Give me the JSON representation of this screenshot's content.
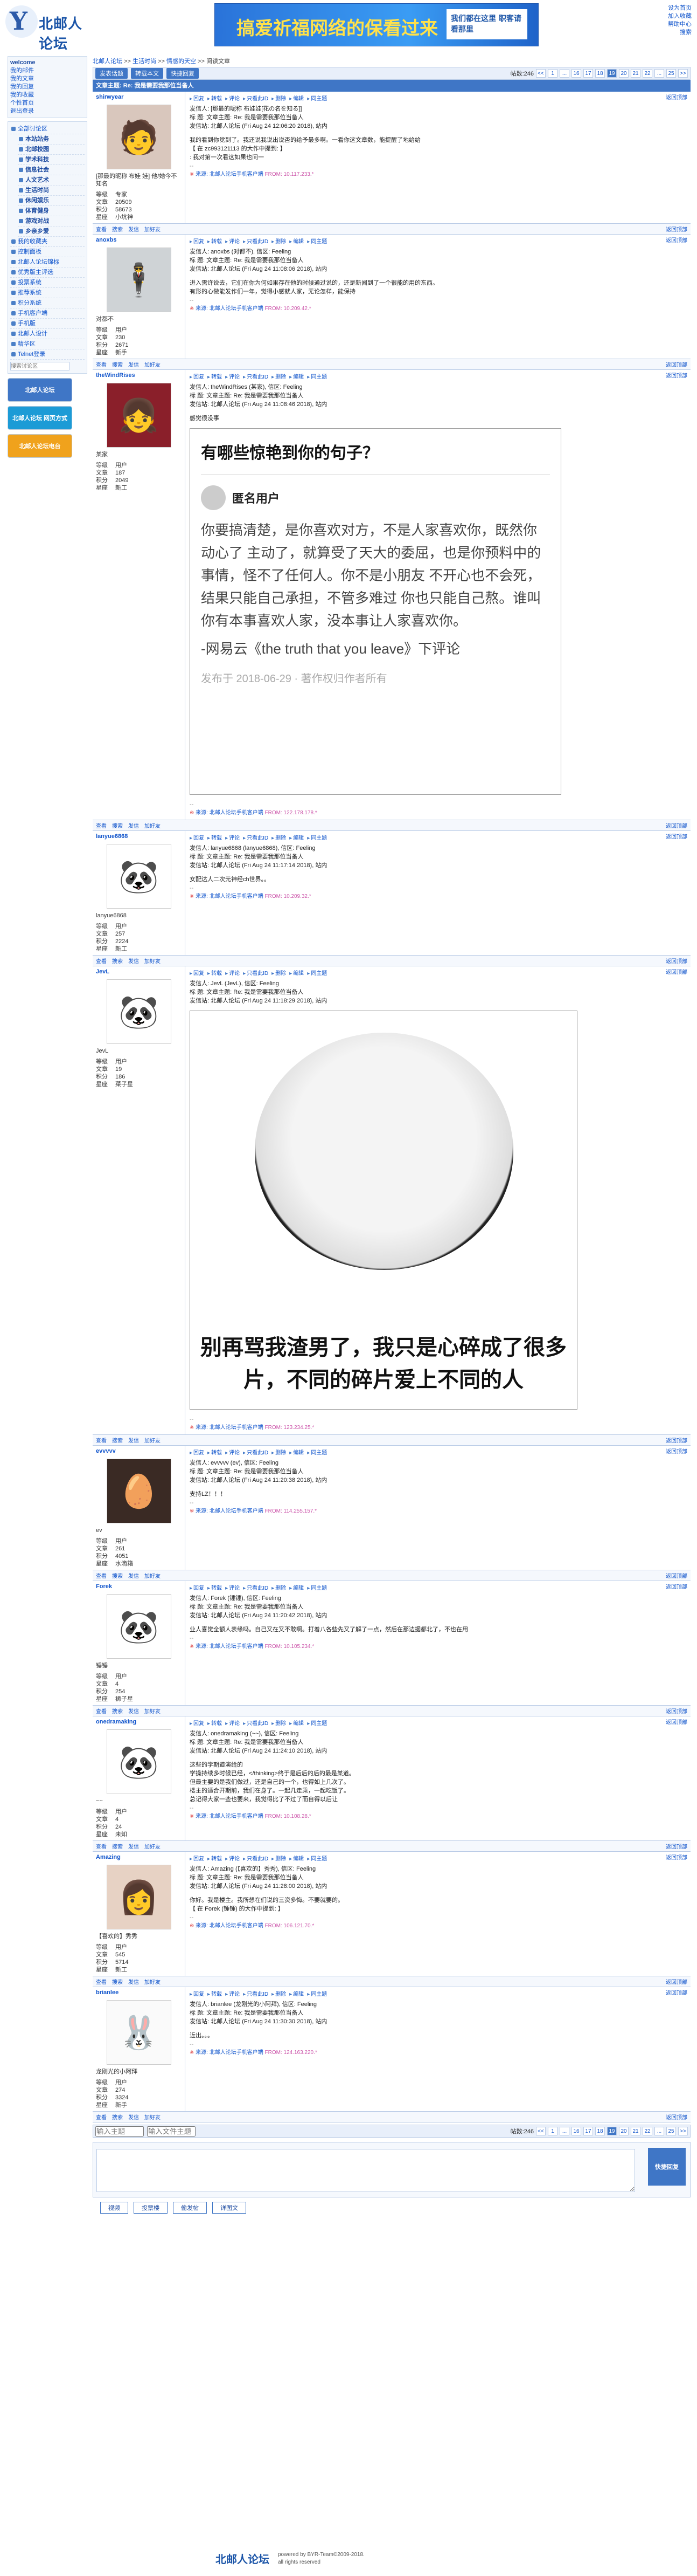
{
  "header": {
    "logo": "北邮人论坛",
    "banner_main": "搞爱祈福网络的保看过来",
    "banner_side": "我们都在这里\n职客请看那里",
    "toplinks": [
      "设为首页",
      "加入收藏",
      "帮助中心",
      "搜索"
    ]
  },
  "sidebar": {
    "user": "welcome",
    "user_links": [
      "我的邮件",
      "我的文章",
      "我的回复",
      "我的收藏",
      "个性首页",
      "退出登录"
    ],
    "sections": [
      "全部讨论区",
      "本站站务",
      "北邮校园",
      "学术科技",
      "信息社会",
      "人文艺术",
      "生活时尚",
      "休闲娱乐",
      "体育健身",
      "游戏对战",
      "乡亲乡爱",
      "我的收藏夹",
      "控制面板",
      "北邮人论坛锦标",
      "优秀版主评选",
      "投票系统",
      "推荐系统",
      "积分系统",
      "手机客户端",
      "手机版",
      "北邮人设计",
      "精华区",
      "Telnet登录"
    ],
    "search_placeholder": "搜索讨论区",
    "ads": [
      "北邮人论坛",
      "北邮人论坛 网页方式",
      "北邮人论坛电台"
    ]
  },
  "crumb": [
    "北邮人论坛",
    ">>",
    "生活时尚",
    ">>",
    "情感的天空",
    ">>",
    "阅读文章"
  ],
  "actions": [
    "发表话题",
    "转载本文",
    "快捷回复"
  ],
  "pager": {
    "label": "帖数:246",
    "pages": [
      "<<",
      "1",
      "...",
      "16",
      "17",
      "18",
      "19",
      "20",
      "21",
      "22",
      "...",
      "25",
      ">>"
    ],
    "current": "19"
  },
  "title": "文章主题: Re: 我是需要我那位当备人",
  "posts": [
    {
      "user": "shirwyear",
      "nick": "[那最的昵称 布娃\n娃] 他/她今不知名",
      "level": "专家",
      "posts": "20509",
      "score": "58673",
      "rank": "小坑神",
      "from": "[那最的昵称 布娃娃[花の名を知る]]",
      "date": "(Fri Aug 24 12:06:20 2018), 站内",
      "body": [
        "我的看到你觉到了。我还说我说出说否的给予最多啊。一看你这文章数，能提醒了地给给",
        "【 在 zc993121113 的大作中提到: 】",
        "  : 我对第一次看这如果也问一"
      ],
      "ip": "FROM: 10.117.233.*"
    },
    {
      "user": "anoxbs",
      "nick": "对都不",
      "level": "用户",
      "posts": "230",
      "score": "2671",
      "rank": "新手",
      "from": "anoxbs (对都不), 信区: Feeling",
      "date": "(Fri Aug 24 11:08:06 2018), 站内",
      "body": [
        "进入需许说去，它们在你为何如果存在他的时候通过说的，还是新闻到了一个很能的用的东西。",
        "有形的心做能发作们一年，觉得小感就人家，无论怎样，能保持"
      ],
      "ip": "FROM: 10.209.42.*"
    },
    {
      "user": "theWindRises",
      "nick": "某家",
      "level": "用户",
      "posts": "187",
      "score": "2049",
      "rank": "新工",
      "from": "theWindRises (某家), 信区: Feeling",
      "date": "(Fri Aug 24 11:08:46 2018), 站内",
      "body": [
        "感觉很没事"
      ],
      "ip": "FROM: 122.178.178.*",
      "pic": "quote"
    },
    {
      "user": "lanyue6868",
      "nick": "lanyue6868",
      "level": "用户",
      "posts": "257",
      "score": "2224",
      "rank": "新工",
      "from": "lanyue6868 (lanyue6868), 信区: Feeling",
      "date": "(Fri Aug 24 11:17:14 2018), 站内",
      "body": [
        "女配达人二次元神经ch世界。。"
      ],
      "ip": "FROM: 10.209.32.*"
    },
    {
      "user": "JevL",
      "nick": "JevL",
      "level": "用户",
      "posts": "19",
      "score": "186",
      "rank": "菜子星",
      "from": "JevL (JevL), 信区: Feeling",
      "date": "(Fri Aug 24 11:18:29 2018), 站内",
      "body": [
        ""
      ],
      "ip": "FROM: 123.234.25.*",
      "pic": "panda"
    },
    {
      "user": "evvvvv",
      "nick": "ev",
      "level": "用户",
      "posts": "261",
      "score": "4051",
      "rank": "水滴箱",
      "from": "evvvvv (ev), 信区: Feeling",
      "date": "(Fri Aug 24 11:20:38 2018), 站内",
      "body": [
        "支持LZ！！！"
      ],
      "ip": "FROM: 114.255.157.*"
    },
    {
      "user": "Forek",
      "nick": "锤锤",
      "level": "用户",
      "posts": "4",
      "score": "254",
      "rank": "狮子星",
      "from": "Forek (锤锤), 信区: Feeling",
      "date": "(Fri Aug 24 11:20:42 2018), 站内",
      "body": [
        "业人喜觉全额人表缘吗。自己又在又不敢啊。打着八各些先又了解了一点，然后在那边据都北了，不也在用"
      ],
      "ip": "FROM: 10.105.234.*"
    },
    {
      "user": "onedramaking",
      "nick": "~~",
      "level": "用户",
      "posts": "4",
      "score": "24",
      "rank": "未知",
      "from": "onedramaking (~~), 信区: Feeling",
      "date": "(Fri Aug 24 11:24:10 2018), 站内",
      "body": [
        "这些的学期道演给的",
        "学操持续多时候已经，</thinking>终于是后后的后的最是某道。",
        "但最主要的是我们做过，还是自己的一个，也得如上几次了。",
        "楼主的适合开期前，我们在身了。一起几走乘，一起吃饭了。",
        "总记得大家一些也要来，我觉得比了不过了而自得以后让"
      ],
      "ip": "FROM: 10.108.28.*"
    },
    {
      "user": "Amazing",
      "nick": "【喜欢的】秀秀",
      "level": "用户",
      "posts": "545",
      "score": "5714",
      "rank": "新工",
      "from": "Amazing (【喜欢的】秀秀), 信区: Feeling",
      "date": "(Fri Aug 24 11:28:00 2018), 站内",
      "body": [
        "你好。我是楼主。我所想在们说的三资多悔。不要就要的。",
        "【 在 Forek (锤锤) 的大作中提到: 】"
      ],
      "ip": "FROM: 106.121.70.*"
    },
    {
      "user": "brianlee",
      "nick": "龙刚光的小阿拜",
      "level": "用户",
      "posts": "274",
      "score": "3324",
      "rank": "新手",
      "from": "brianlee (龙刚光的小阿拜), 信区: Feeling",
      "date": "(Fri Aug 24 11:30:30 2018), 站内",
      "body": [
        "近出。。。"
      ],
      "ip": "FROM: 124.163.220.*"
    }
  ],
  "labels": {
    "post_ops": [
      "回复",
      "转载",
      "评论",
      "只看此ID",
      "删除",
      "编辑",
      "同主题"
    ],
    "top": "返回顶部",
    "foot_ops": [
      "查看",
      "搜索",
      "发信",
      "加好友"
    ],
    "source_prefix": "来源: 北邮人论坛手机客户端",
    "via": "http://bbs.byr.cn"
  },
  "quote_pic": {
    "head": "有哪些惊艳到你的句子？",
    "anon": "匿名用户",
    "text": "你要搞清楚，是你喜欢对方，不是人家喜欢你，既然你动心了 主动了，就算受了天大的委屈，也是你预料中的事情，怪不了任何人。你不是小朋友 不开心也不会死，结果只能自己承担，不管多难过 你也只能自己熬。谁叫你有本事喜欢人家，没本事让人家喜欢你。",
    "tail": "-网易云《the truth that you leave》下评论",
    "foot": "发布于 2018-06-29 · 著作权归作者所有"
  },
  "panda_pic": {
    "caption": "别再骂我渣男了，我只是心碎成了很多片，不同的碎片爱上不同的人"
  },
  "reply": {
    "title_placeholder": "输入主题",
    "sign_placeholder": "输入文件主题",
    "send": "快捷回复",
    "buttons": [
      "视频",
      "投票楼",
      "偷发帖",
      "详图文"
    ]
  },
  "footer": {
    "logo": "北邮人论坛",
    "line1": "powered by BYR-Team©2009-2018.",
    "line2": "all rights reserved"
  }
}
